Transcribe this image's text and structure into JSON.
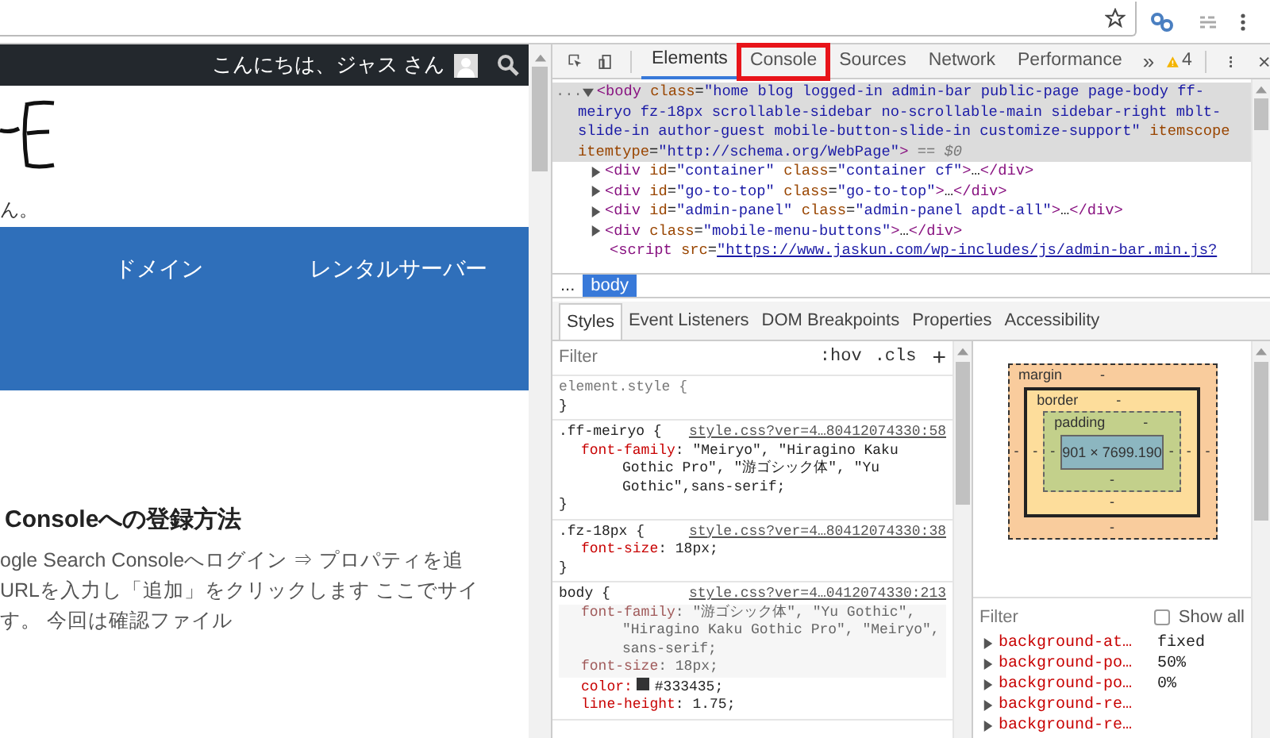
{
  "admin_bar": {
    "greeting": "こんにちは、ジャス さん"
  },
  "site_header": {
    "tagline": "ん。"
  },
  "nav": {
    "items": [
      {
        "label": "ドメイン"
      },
      {
        "label": "レンタルサーバー"
      }
    ]
  },
  "article": {
    "heading": "Consoleへの登録方法",
    "lines": [
      "ogle Search Consoleへログイン ⇒ プロパティを追",
      "URLを入力し「追加」をクリックします ここでサイ",
      "す。 今回は確認ファイル"
    ]
  },
  "devtools": {
    "tabs": [
      {
        "label": "Elements",
        "selected": true,
        "highlighted": false
      },
      {
        "label": "Console",
        "selected": false,
        "highlighted": true
      },
      {
        "label": "Sources",
        "selected": false,
        "highlighted": false
      },
      {
        "label": "Network",
        "selected": false,
        "highlighted": false
      },
      {
        "label": "Performance",
        "selected": false,
        "highlighted": false
      }
    ],
    "overflow": "»",
    "warnings": "4",
    "dom_lines": [
      {
        "kind": "open",
        "selected": true,
        "prefix": "...",
        "tokens": [
          {
            "kind": "tag",
            "text": "<body"
          },
          {
            "kind": "attr",
            "text": " class"
          },
          {
            "kind": "plain",
            "text": "="
          },
          {
            "kind": "value",
            "text": "\"home blog logged-in admin-bar public-page page-body ff-"
          }
        ]
      },
      {
        "kind": "continuation",
        "selected": true,
        "tokens": [
          {
            "kind": "value",
            "text": "meiryo fz-18px scrollable-sidebar no-scrollable-main sidebar-right mblt-"
          }
        ]
      },
      {
        "kind": "continuation",
        "selected": true,
        "tokens": [
          {
            "kind": "value",
            "text": "slide-in author-guest mobile-button-slide-in customize-support\""
          },
          {
            "kind": "attr",
            "text": " itemscope"
          }
        ]
      },
      {
        "kind": "continuation",
        "selected": true,
        "tokens": [
          {
            "kind": "attr",
            "text": "itemtype"
          },
          {
            "kind": "plain",
            "text": "="
          },
          {
            "kind": "value",
            "text": "\"http://schema.org/WebPage\""
          },
          {
            "kind": "tag",
            "text": ">"
          },
          {
            "kind": "note",
            "text": " == $0"
          }
        ]
      },
      {
        "kind": "child",
        "selected": false,
        "tokens": [
          {
            "kind": "tag",
            "text": "<div"
          },
          {
            "kind": "attr",
            "text": " id"
          },
          {
            "kind": "plain",
            "text": "="
          },
          {
            "kind": "value",
            "text": "\"container\""
          },
          {
            "kind": "attr",
            "text": " class"
          },
          {
            "kind": "plain",
            "text": "="
          },
          {
            "kind": "value",
            "text": "\"container cf\""
          },
          {
            "kind": "tag",
            "text": ">"
          },
          {
            "kind": "plain",
            "text": "…"
          },
          {
            "kind": "tag",
            "text": "</div>"
          }
        ]
      },
      {
        "kind": "child",
        "selected": false,
        "tokens": [
          {
            "kind": "tag",
            "text": "<div"
          },
          {
            "kind": "attr",
            "text": " id"
          },
          {
            "kind": "plain",
            "text": "="
          },
          {
            "kind": "value",
            "text": "\"go-to-top\""
          },
          {
            "kind": "attr",
            "text": " class"
          },
          {
            "kind": "plain",
            "text": "="
          },
          {
            "kind": "value",
            "text": "\"go-to-top\""
          },
          {
            "kind": "tag",
            "text": ">"
          },
          {
            "kind": "plain",
            "text": "…"
          },
          {
            "kind": "tag",
            "text": "</div>"
          }
        ]
      },
      {
        "kind": "child",
        "selected": false,
        "tokens": [
          {
            "kind": "tag",
            "text": "<div"
          },
          {
            "kind": "attr",
            "text": " id"
          },
          {
            "kind": "plain",
            "text": "="
          },
          {
            "kind": "value",
            "text": "\"admin-panel\""
          },
          {
            "kind": "attr",
            "text": " class"
          },
          {
            "kind": "plain",
            "text": "="
          },
          {
            "kind": "value",
            "text": "\"admin-panel apdt-all\""
          },
          {
            "kind": "tag",
            "text": ">"
          },
          {
            "kind": "plain",
            "text": "…"
          },
          {
            "kind": "tag",
            "text": "</div>"
          }
        ]
      },
      {
        "kind": "child",
        "selected": false,
        "tokens": [
          {
            "kind": "tag",
            "text": "<div"
          },
          {
            "kind": "attr",
            "text": " class"
          },
          {
            "kind": "plain",
            "text": "="
          },
          {
            "kind": "value",
            "text": "\"mobile-menu-buttons\""
          },
          {
            "kind": "tag",
            "text": ">"
          },
          {
            "kind": "plain",
            "text": "…"
          },
          {
            "kind": "tag",
            "text": "</div>"
          }
        ]
      },
      {
        "kind": "leaf",
        "selected": false,
        "tokens": [
          {
            "kind": "tag",
            "text": "<script"
          },
          {
            "kind": "attr",
            "text": " src"
          },
          {
            "kind": "plain",
            "text": "="
          },
          {
            "kind": "link",
            "text": "\"https://www.jaskun.com/wp-includes/js/admin-bar.min.js?"
          }
        ]
      }
    ],
    "breadcrumbs": [
      {
        "label": "...",
        "selected": false
      },
      {
        "label": "body",
        "selected": true
      }
    ],
    "subtabs": [
      {
        "label": "Styles",
        "selected": true
      },
      {
        "label": "Event Listeners",
        "selected": false
      },
      {
        "label": "DOM Breakpoints",
        "selected": false
      },
      {
        "label": "Properties",
        "selected": false
      },
      {
        "label": "Accessibility",
        "selected": false
      }
    ],
    "styles_filter": {
      "placeholder": "Filter",
      "hov": ":hov",
      "cls": ".cls",
      "add": "+"
    },
    "rules": [
      {
        "selector": "element.style {",
        "close": "}"
      },
      {
        "selector": ".ff-meiryo {",
        "source": "style.css?ver=4…80412074330:58",
        "close": "}",
        "properties": [
          {
            "name": "font-family",
            "value": ": \"Meiryo\", \"Hiragino Kaku Gothic Pro\", \"游ゴシック体\", \"Yu Gothic\",sans-serif;",
            "struck": false
          }
        ]
      },
      {
        "selector": ".fz-18px {",
        "source": "style.css?ver=4…80412074330:38",
        "close": "}",
        "properties": [
          {
            "name": "font-size",
            "value": ": 18px;",
            "struck": false
          }
        ]
      },
      {
        "selector": "body {",
        "source": "style.css?ver=4…0412074330:213",
        "properties": [
          {
            "name": "font-family",
            "value": ": \"游ゴシック体\", \"Yu Gothic\", \"Hiragino Kaku Gothic Pro\", \"Meiryo\", sans-serif;",
            "struck": true
          },
          {
            "name": "font-size",
            "value": ": 18px;",
            "struck": true
          },
          {
            "name": "color:",
            "value": "#333435;",
            "color": "#333435",
            "struck": false
          },
          {
            "name": "line-height",
            "value": ": 1.75;",
            "struck": false
          }
        ]
      }
    ],
    "box_model": {
      "margin": {
        "label": "margin",
        "top": "-",
        "right": "-",
        "bottom": "-",
        "left": "-"
      },
      "border": {
        "label": "border",
        "top": "-",
        "right": "-",
        "bottom": "-",
        "left": "-"
      },
      "padding": {
        "label": "padding",
        "top": "-",
        "right": "-",
        "bottom": "-",
        "left": "-"
      },
      "content": "901 × 7699.190"
    },
    "computed": {
      "placeholder": "Filter",
      "show_all": {
        "label": "Show all",
        "checked": false
      },
      "properties": [
        {
          "name": "background-at…",
          "value": "fixed",
          "expanded": false
        },
        {
          "name": "background-po…",
          "value": "50%",
          "expanded": false
        },
        {
          "name": "background-po…",
          "value": "0%",
          "expanded": false
        },
        {
          "name": "background-re…",
          "expanded": false
        },
        {
          "name": "background-re…",
          "expanded": false
        }
      ]
    }
  }
}
